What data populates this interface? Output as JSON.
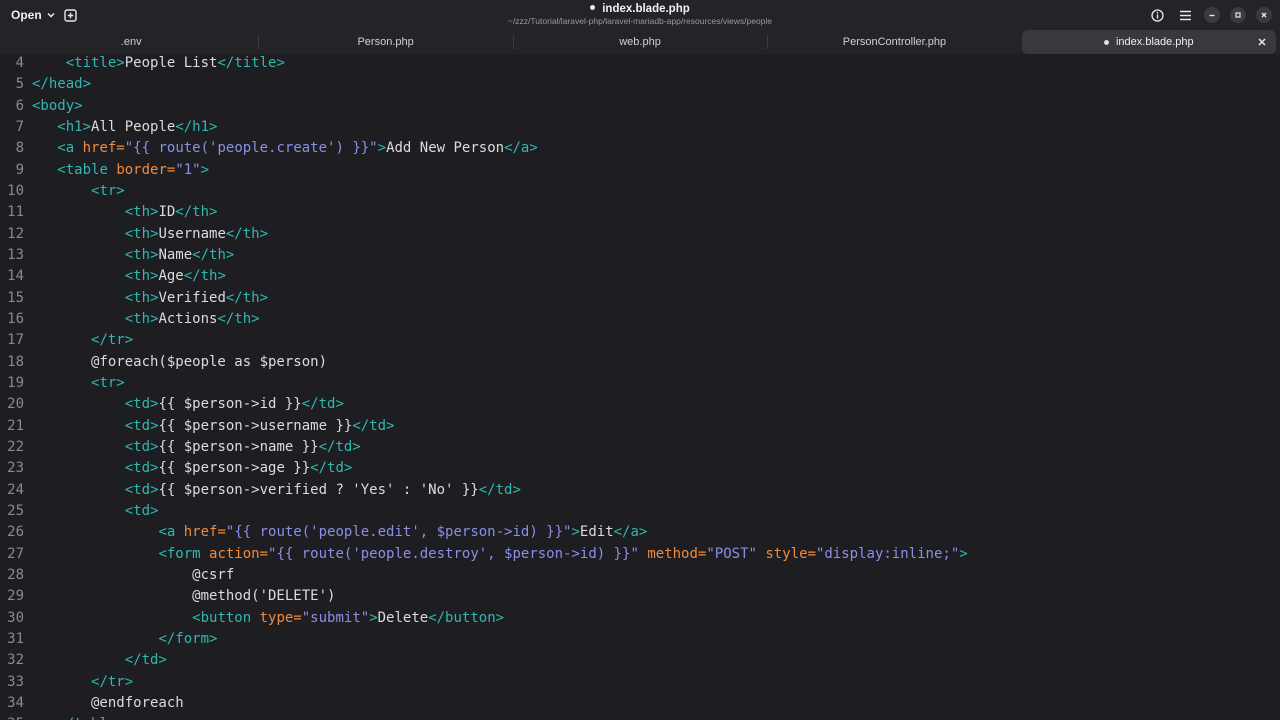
{
  "header": {
    "open_label": "Open",
    "title": "index.blade.php",
    "path": "~/zzz/Tutorial/laravel-php/laravel-mariadb-app/resources/views/people",
    "modified": true
  },
  "tabs": [
    {
      "label": ".env",
      "active": false,
      "modified": false
    },
    {
      "label": "Person.php",
      "active": false,
      "modified": false
    },
    {
      "label": "web.php",
      "active": false,
      "modified": false
    },
    {
      "label": "PersonController.php",
      "active": false,
      "modified": false
    },
    {
      "label": "index.blade.php",
      "active": true,
      "modified": true
    }
  ],
  "colors": {
    "tag": "#2eb8b0",
    "attribute": "#f08a3c",
    "string": "#8c8ee6",
    "text": "#dcdcdc",
    "line_number": "#8a8a8a",
    "background": "#1e1e22"
  },
  "icons": [
    "chevron-down-icon",
    "new-tab-icon",
    "info-icon",
    "menu-icon",
    "minimize-icon",
    "maximize-icon",
    "close-icon"
  ],
  "lines": [
    {
      "n": "4",
      "tokens": [
        [
          "x",
          "    "
        ],
        [
          "t",
          "<title>"
        ],
        [
          "x",
          "People List"
        ],
        [
          "t",
          "</title>"
        ]
      ]
    },
    {
      "n": "5",
      "tokens": [
        [
          "t",
          "</head>"
        ]
      ]
    },
    {
      "n": "6",
      "tokens": [
        [
          "t",
          "<body>"
        ]
      ]
    },
    {
      "n": "7",
      "tokens": [
        [
          "x",
          "   "
        ],
        [
          "t",
          "<h1>"
        ],
        [
          "x",
          "All People"
        ],
        [
          "t",
          "</h1>"
        ]
      ]
    },
    {
      "n": "8",
      "tokens": [
        [
          "x",
          "   "
        ],
        [
          "t",
          "<a "
        ],
        [
          "a",
          "href="
        ],
        [
          "s",
          "\"{{ route('people.create') }}\""
        ],
        [
          "t",
          ">"
        ],
        [
          "x",
          "Add New Person"
        ],
        [
          "t",
          "</a>"
        ]
      ]
    },
    {
      "n": "9",
      "tokens": [
        [
          "x",
          "   "
        ],
        [
          "t",
          "<table "
        ],
        [
          "a",
          "border="
        ],
        [
          "s",
          "\"1\""
        ],
        [
          "t",
          ">"
        ]
      ]
    },
    {
      "n": "10",
      "tokens": [
        [
          "x",
          "       "
        ],
        [
          "t",
          "<tr>"
        ]
      ]
    },
    {
      "n": "11",
      "tokens": [
        [
          "x",
          "           "
        ],
        [
          "t",
          "<th>"
        ],
        [
          "x",
          "ID"
        ],
        [
          "t",
          "</th>"
        ]
      ]
    },
    {
      "n": "12",
      "tokens": [
        [
          "x",
          "           "
        ],
        [
          "t",
          "<th>"
        ],
        [
          "x",
          "Username"
        ],
        [
          "t",
          "</th>"
        ]
      ]
    },
    {
      "n": "13",
      "tokens": [
        [
          "x",
          "           "
        ],
        [
          "t",
          "<th>"
        ],
        [
          "x",
          "Name"
        ],
        [
          "t",
          "</th>"
        ]
      ]
    },
    {
      "n": "14",
      "tokens": [
        [
          "x",
          "           "
        ],
        [
          "t",
          "<th>"
        ],
        [
          "x",
          "Age"
        ],
        [
          "t",
          "</th>"
        ]
      ]
    },
    {
      "n": "15",
      "tokens": [
        [
          "x",
          "           "
        ],
        [
          "t",
          "<th>"
        ],
        [
          "x",
          "Verified"
        ],
        [
          "t",
          "</th>"
        ]
      ]
    },
    {
      "n": "16",
      "tokens": [
        [
          "x",
          "           "
        ],
        [
          "t",
          "<th>"
        ],
        [
          "x",
          "Actions"
        ],
        [
          "t",
          "</th>"
        ]
      ]
    },
    {
      "n": "17",
      "tokens": [
        [
          "x",
          "       "
        ],
        [
          "t",
          "</tr>"
        ]
      ]
    },
    {
      "n": "18",
      "tokens": [
        [
          "x",
          "       @foreach($people as $person)"
        ]
      ]
    },
    {
      "n": "19",
      "tokens": [
        [
          "x",
          "       "
        ],
        [
          "t",
          "<tr>"
        ]
      ]
    },
    {
      "n": "20",
      "tokens": [
        [
          "x",
          "           "
        ],
        [
          "t",
          "<td>"
        ],
        [
          "x",
          "{{ $person->id }}"
        ],
        [
          "t",
          "</td>"
        ]
      ]
    },
    {
      "n": "21",
      "tokens": [
        [
          "x",
          "           "
        ],
        [
          "t",
          "<td>"
        ],
        [
          "x",
          "{{ $person->username }}"
        ],
        [
          "t",
          "</td>"
        ]
      ]
    },
    {
      "n": "22",
      "tokens": [
        [
          "x",
          "           "
        ],
        [
          "t",
          "<td>"
        ],
        [
          "x",
          "{{ $person->name }}"
        ],
        [
          "t",
          "</td>"
        ]
      ]
    },
    {
      "n": "23",
      "tokens": [
        [
          "x",
          "           "
        ],
        [
          "t",
          "<td>"
        ],
        [
          "x",
          "{{ $person->age }}"
        ],
        [
          "t",
          "</td>"
        ]
      ]
    },
    {
      "n": "24",
      "tokens": [
        [
          "x",
          "           "
        ],
        [
          "t",
          "<td>"
        ],
        [
          "x",
          "{{ $person->verified ? 'Yes' : 'No' }}"
        ],
        [
          "t",
          "</td>"
        ]
      ]
    },
    {
      "n": "25",
      "tokens": [
        [
          "x",
          "           "
        ],
        [
          "t",
          "<td>"
        ]
      ]
    },
    {
      "n": "26",
      "tokens": [
        [
          "x",
          "               "
        ],
        [
          "t",
          "<a "
        ],
        [
          "a",
          "href="
        ],
        [
          "s",
          "\"{{ route('people.edit', $person->id) }}\""
        ],
        [
          "t",
          ">"
        ],
        [
          "x",
          "Edit"
        ],
        [
          "t",
          "</a>"
        ]
      ]
    },
    {
      "n": "27",
      "tokens": [
        [
          "x",
          "               "
        ],
        [
          "t",
          "<form "
        ],
        [
          "a",
          "action="
        ],
        [
          "s",
          "\"{{ route('people.destroy', $person->id) }}\""
        ],
        [
          "x",
          " "
        ],
        [
          "a",
          "method="
        ],
        [
          "s",
          "\"POST\""
        ],
        [
          "x",
          " "
        ],
        [
          "a",
          "style="
        ],
        [
          "s",
          "\"display:inline;\""
        ],
        [
          "t",
          ">"
        ]
      ]
    },
    {
      "n": "28",
      "tokens": [
        [
          "x",
          "                   @csrf"
        ]
      ]
    },
    {
      "n": "29",
      "tokens": [
        [
          "x",
          "                   @method('DELETE')"
        ]
      ]
    },
    {
      "n": "30",
      "tokens": [
        [
          "x",
          "                   "
        ],
        [
          "t",
          "<button "
        ],
        [
          "a",
          "type="
        ],
        [
          "s",
          "\"submit\""
        ],
        [
          "t",
          ">"
        ],
        [
          "x",
          "Delete"
        ],
        [
          "t",
          "</button>"
        ]
      ]
    },
    {
      "n": "31",
      "tokens": [
        [
          "x",
          "               "
        ],
        [
          "t",
          "</form>"
        ]
      ]
    },
    {
      "n": "32",
      "tokens": [
        [
          "x",
          "           "
        ],
        [
          "t",
          "</td>"
        ]
      ]
    },
    {
      "n": "33",
      "tokens": [
        [
          "x",
          "       "
        ],
        [
          "t",
          "</tr>"
        ]
      ]
    },
    {
      "n": "34",
      "tokens": [
        [
          "x",
          "       @endforeach"
        ]
      ]
    },
    {
      "n": "35",
      "tokens": [
        [
          "x",
          "   "
        ],
        [
          "t",
          "</table>"
        ]
      ]
    }
  ]
}
